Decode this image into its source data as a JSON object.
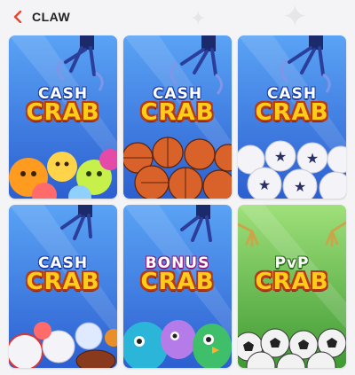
{
  "header": {
    "back_icon": "chevron-left-icon",
    "title": "CLAW",
    "accent": "#e8442f"
  },
  "cards": [
    {
      "top": "CASH",
      "main": "CRAB",
      "theme": "emoji balls",
      "bg": "#3f7fe6"
    },
    {
      "top": "CASH",
      "main": "CRAB",
      "theme": "basketballs",
      "bg": "#3f7fe6"
    },
    {
      "top": "CASH",
      "main": "CRAB",
      "theme": "star balls",
      "bg": "#3f7fe6"
    },
    {
      "top": "CASH",
      "main": "CRAB",
      "theme": "sports balls",
      "bg": "#3f7fe6"
    },
    {
      "top": "BONUS",
      "main": "CRAB",
      "theme": "plush monsters",
      "bg": "#3f7fe6"
    },
    {
      "top": "PvP",
      "main": "CRAB",
      "theme": "soccer balls",
      "bg": "#6fbf4a"
    }
  ]
}
